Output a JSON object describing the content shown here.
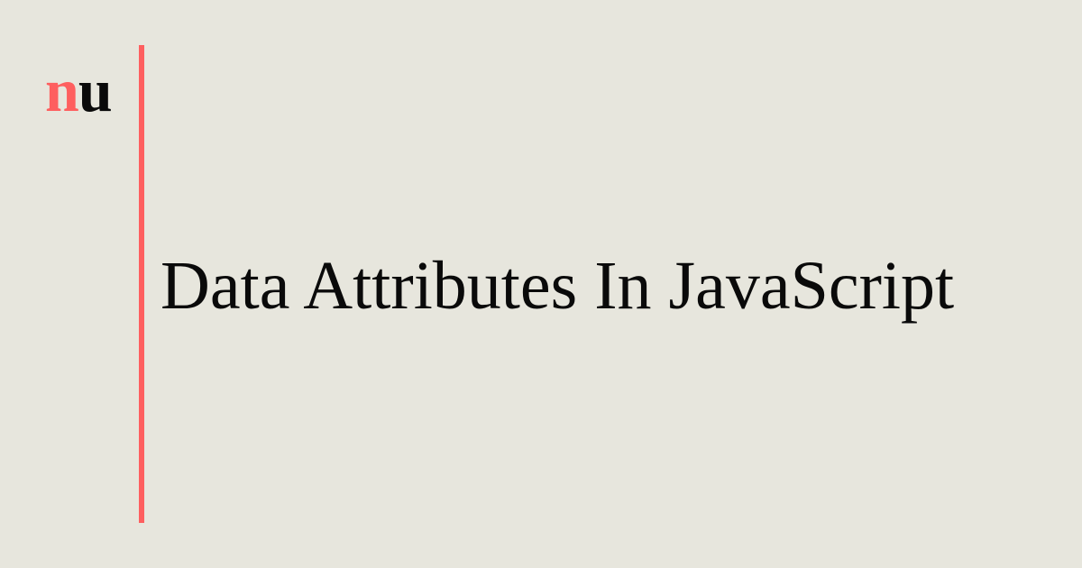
{
  "logo": {
    "first_letter": "n",
    "second_letter": "u",
    "accent_color": "#fe5f5f",
    "text_color": "#0a0a0a"
  },
  "title": "Data Attributes In JavaScript",
  "colors": {
    "background": "#e7e6dd",
    "divider": "#fe5f5f"
  }
}
